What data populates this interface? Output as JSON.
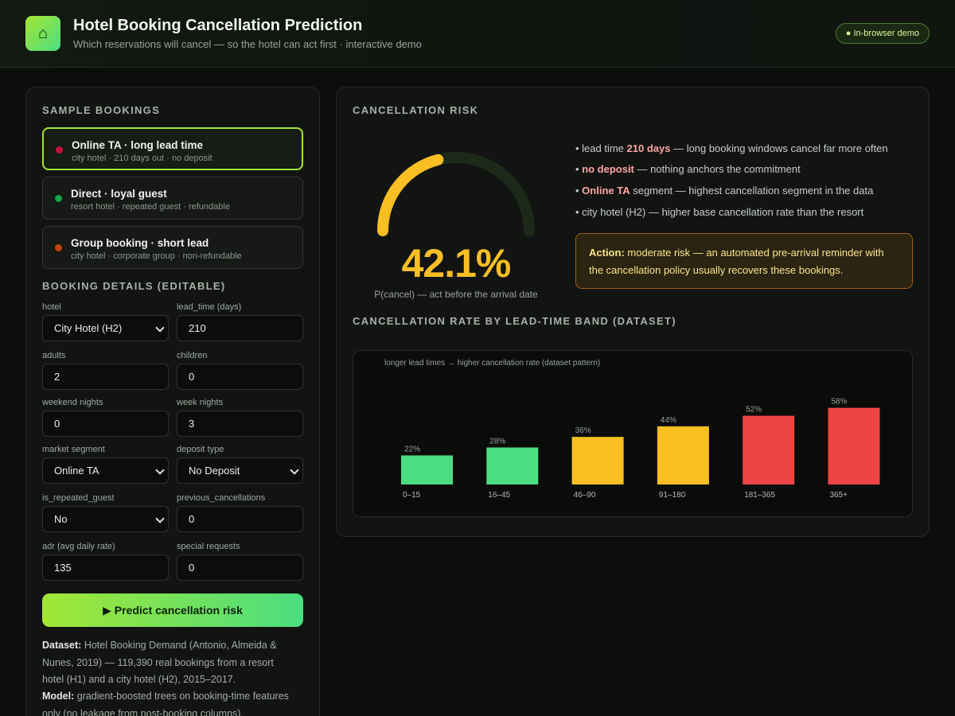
{
  "header": {
    "logo_icon": "⌂",
    "title": "Hotel Booking Cancellation Prediction",
    "subtitle": "Which reservations will cancel — so the hotel can act first · interactive demo",
    "badge": "● In-browser demo"
  },
  "samples": {
    "title": "SAMPLE BOOKINGS",
    "items": [
      {
        "title": "Online TA · long lead time",
        "sub": "city hotel · 210 days out · no deposit",
        "color": "#be123c"
      },
      {
        "title": "Direct · loyal guest",
        "sub": "resort hotel · repeated guest · refundable",
        "color": "#16a34a"
      },
      {
        "title": "Group booking · short lead",
        "sub": "city hotel · corporate group · non-refundable",
        "color": "#c2410c"
      }
    ]
  },
  "form": {
    "title": "BOOKING DETAILS (EDITABLE)",
    "fields": {
      "hotel": {
        "label": "hotel",
        "value": "City Hotel (H2)"
      },
      "lead_time": {
        "label": "lead_time (days)",
        "value": "210"
      },
      "adults": {
        "label": "adults",
        "value": "2"
      },
      "children": {
        "label": "children",
        "value": "0"
      },
      "weekend_nights": {
        "label": "weekend nights",
        "value": "0"
      },
      "week_nights": {
        "label": "week nights",
        "value": "3"
      },
      "market_segment": {
        "label": "market segment",
        "value": "Online TA"
      },
      "deposit_type": {
        "label": "deposit type",
        "value": "No Deposit"
      },
      "is_repeated_guest": {
        "label": "is_repeated_guest",
        "value": "No"
      },
      "previous_cancellations": {
        "label": "previous_cancellations",
        "value": "0"
      },
      "adr": {
        "label": "adr (avg daily rate)",
        "value": "135"
      },
      "special_requests": {
        "label": "special requests",
        "value": "0"
      }
    },
    "predict_button": "▶ Predict cancellation risk"
  },
  "info": {
    "dataset_label": "Dataset:",
    "dataset_text": "Hotel Booking Demand (Antonio, Almeida & Nunes, 2019) — 119,390 real bookings from a resort hotel (H1) and a city hotel (H2), 2015–2017.",
    "model_label": "Model:",
    "model_text": "gradient-boosted trees on booking-time features only (no leakage from post-booking columns)."
  },
  "risk": {
    "title": "CANCELLATION RISK",
    "probability": 0.421,
    "value_text": "42.1%",
    "caption": "P(cancel) — act before the arrival date",
    "colors": {
      "gauge": "#fbbf24",
      "track": "#1d2a1a",
      "accent_red": "#fca5a5"
    },
    "reasons": [
      {
        "pre": "• lead time ",
        "hl": "210 days",
        "post": " — long booking windows cancel far more often"
      },
      {
        "pre": "• ",
        "hl": "no deposit",
        "post": " — nothing anchors the commitment"
      },
      {
        "pre": "• ",
        "hl": "Online TA",
        "post": " segment — highest cancellation segment in the data"
      },
      {
        "pre": "• city hotel (H2) — higher base cancellation rate than the resort",
        "hl": "",
        "post": ""
      }
    ],
    "action_label": "Action:",
    "action_text": "moderate risk — an automated pre-arrival reminder with the cancellation policy usually recovers these bookings."
  },
  "chart_section": {
    "title": "CANCELLATION RATE BY LEAD-TIME BAND (DATASET)"
  },
  "chart_data": {
    "type": "bar",
    "title": "",
    "annotation": "longer lead times → higher cancellation rate (dataset pattern)",
    "categories": [
      "0–15",
      "16–45",
      "46–90",
      "91–180",
      "181–365",
      "365+"
    ],
    "values": [
      22,
      28,
      36,
      44,
      52,
      58
    ],
    "value_labels": [
      "22%",
      "28%",
      "36%",
      "44%",
      "52%",
      "58%"
    ],
    "colors": [
      "#4ade80",
      "#4ade80",
      "#fbbf24",
      "#fbbf24",
      "#ef4444",
      "#ef4444"
    ],
    "ylim": [
      0,
      65
    ],
    "xlabel": "",
    "ylabel": "",
    "grid": false
  }
}
